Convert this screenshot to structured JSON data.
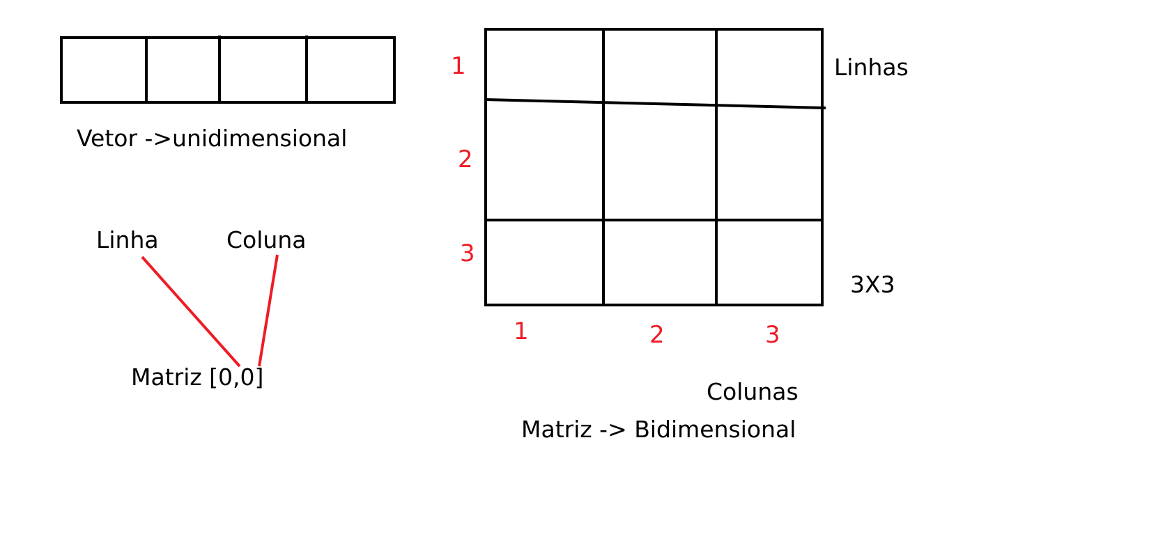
{
  "vector": {
    "label": "Vetor ->unidimensional",
    "cells": 4
  },
  "index_annotation": {
    "row_label": "Linha",
    "col_label": "Coluna",
    "expression": "Matriz [0,0]"
  },
  "matrix": {
    "rows_label": "Linhas",
    "cols_label": "Colunas",
    "size_label": "3X3",
    "title": "Matriz -> Bidimensional",
    "row_numbers": [
      "1",
      "2",
      "3"
    ],
    "col_numbers": [
      "1",
      "2",
      "3"
    ]
  },
  "colors": {
    "ink": "#000000",
    "accent": "#ee1c25",
    "background": "#ffffff"
  }
}
